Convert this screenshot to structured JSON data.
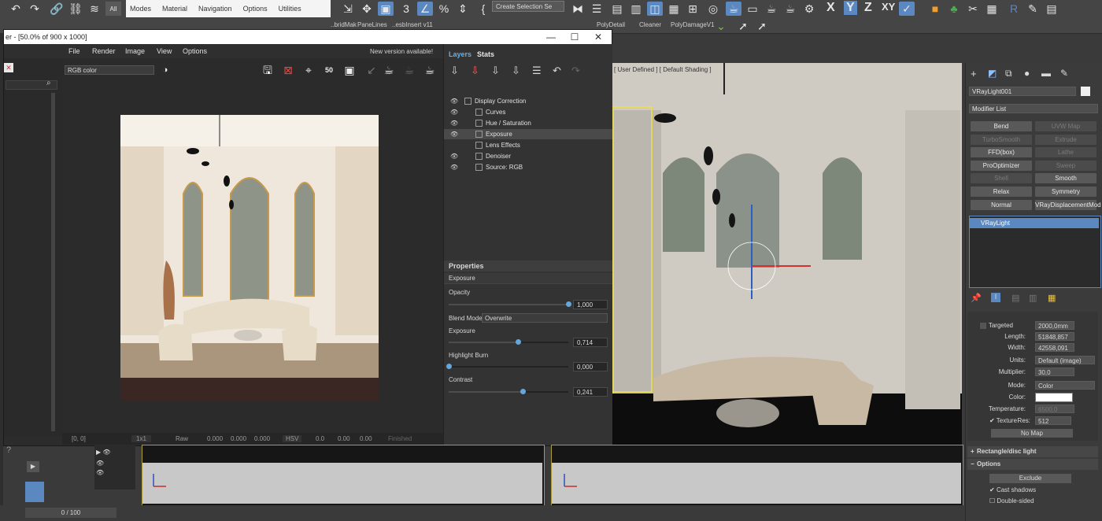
{
  "toolbar": {
    "all_label": "All",
    "menus": [
      "Modes",
      "Material",
      "Navigation",
      "Options",
      "Utilities"
    ],
    "selection_set": "Create Selection Se",
    "axes": [
      "X",
      "Y",
      "Z",
      "XY"
    ],
    "ribbon_tabs": [
      "..bridMak",
      "PaneLines",
      "..esbInsert v11",
      "PolyDetail",
      "Cleaner",
      "PolyDamageV1"
    ]
  },
  "viewport": {
    "label": "[ User Defined ] [ Default Shading ]"
  },
  "vfb": {
    "title": "er - [50.0% of 900 x 1000]",
    "menus": [
      "File",
      "Render",
      "Image",
      "View",
      "Options"
    ],
    "new_version": "New version available!",
    "channel": "RGB color",
    "zoom_badge": "50",
    "status": {
      "coords": "[0, 0]",
      "ratio": "1x1",
      "raw": "Raw",
      "r": "0.000",
      "g": "0.000",
      "b": "0.000",
      "mode": "HSV",
      "h": "0.0",
      "s": "0.00",
      "v": "0.00",
      "finished": "Finished"
    }
  },
  "layers": {
    "tabs": [
      "Layers",
      "Stats"
    ],
    "items": [
      {
        "label": "Display Correction",
        "visible": true
      },
      {
        "label": "Curves",
        "visible": true
      },
      {
        "label": "Hue / Saturation",
        "visible": true
      },
      {
        "label": "Exposure",
        "visible": true,
        "selected": true
      },
      {
        "label": "Lens Effects",
        "visible": false
      },
      {
        "label": "Denoiser",
        "visible": true
      },
      {
        "label": "Source: RGB",
        "visible": true
      }
    ],
    "properties_title": "Properties",
    "properties_sub": "Exposure",
    "opacity_label": "Opacity",
    "opacity_value": "1,000",
    "opacity_fraction": 1.0,
    "blend_label": "Blend Mode",
    "blend_value": "Overwrite",
    "exposure_label": "Exposure",
    "exposure_value": "0,714",
    "exposure_fraction": 0.58,
    "burn_label": "Highlight Burn",
    "burn_value": "0,000",
    "burn_fraction": 0.0,
    "contrast_label": "Contrast",
    "contrast_value": "0,241",
    "contrast_fraction": 0.62
  },
  "command_panel": {
    "object_name": "VRayLight001",
    "modifier_list": "Modifier List",
    "buttons": [
      {
        "label": "Bend",
        "dim": false
      },
      {
        "label": "UVW Map",
        "dim": true
      },
      {
        "label": "TurboSmooth",
        "dim": true
      },
      {
        "label": "Extrude",
        "dim": true
      },
      {
        "label": "FFD(box)",
        "dim": false
      },
      {
        "label": "Lathe",
        "dim": true
      },
      {
        "label": "ProOptimizer",
        "dim": false
      },
      {
        "label": "Sweep",
        "dim": true
      },
      {
        "label": "Shell",
        "dim": true
      },
      {
        "label": "Smooth",
        "dim": false
      },
      {
        "label": "Relax",
        "dim": false
      },
      {
        "label": "Symmetry",
        "dim": false
      },
      {
        "label": "Normal",
        "dim": false
      },
      {
        "label": "VRayDisplacementMod",
        "dim": false
      }
    ],
    "stack_item": "VRayLight",
    "params": {
      "targeted_label": "Targeted",
      "targeted_value": "2000,0mm",
      "length_label": "Length:",
      "length_value": "51848,857",
      "width_label": "Width:",
      "width_value": "42558,091",
      "units_label": "Units:",
      "units_value": "Default (image)",
      "multiplier_label": "Multiplier:",
      "multiplier_value": "30,0",
      "mode_label": "Mode:",
      "mode_value": "Color",
      "color_label": "Color:",
      "color_swatch": "#ffffff",
      "temperature_label": "Temperature:",
      "temperature_value": "6500,0",
      "texture_label": "Texture",
      "res_label": "Res:",
      "res_value": "512",
      "no_map": "No Map"
    },
    "sections": [
      "Rectangle/disc light",
      "Options"
    ],
    "exclude": "Exclude",
    "cast_shadows": "Cast shadows",
    "double_sided": "Double-sided"
  },
  "timeline": {
    "frame": "0 / 100"
  },
  "colors": {
    "accent": "#5b88c0",
    "slider": "#62a8e0",
    "viewport_frame": "#ad9b3a"
  }
}
